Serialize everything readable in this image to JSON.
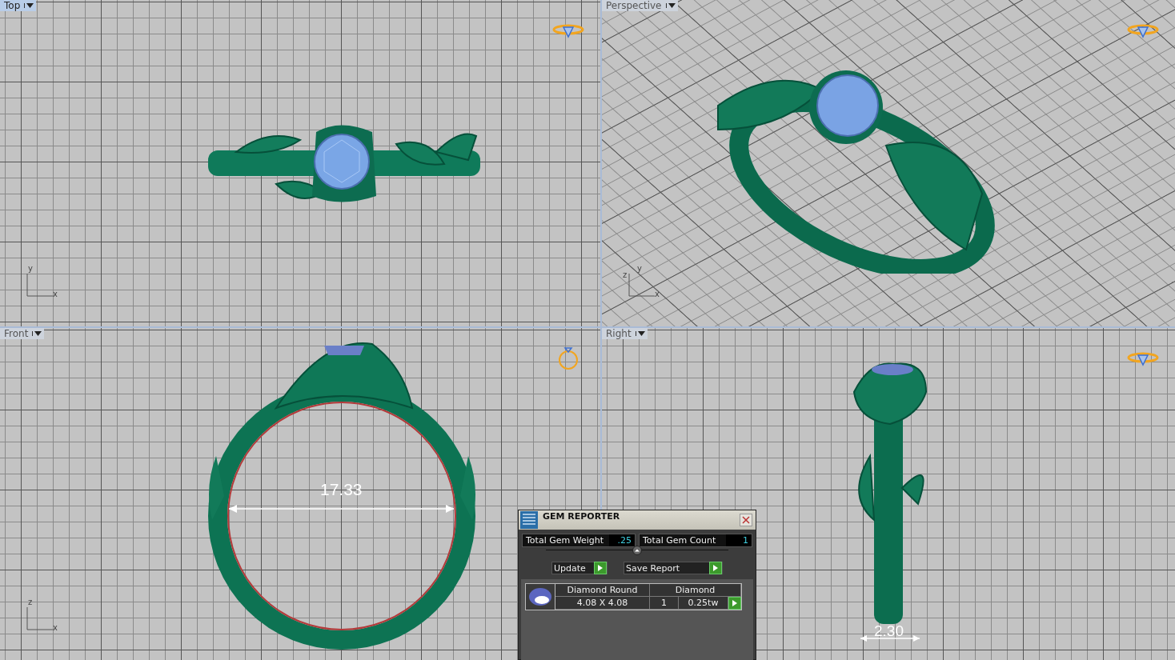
{
  "viewports": [
    {
      "label": "Top",
      "selected": true,
      "kind": "top",
      "axes": [
        "y",
        "x"
      ]
    },
    {
      "label": "Perspective",
      "selected": false,
      "kind": "perspective",
      "axes": [
        "z",
        "y",
        "x"
      ]
    },
    {
      "label": "Front",
      "selected": false,
      "kind": "front",
      "axes": [
        "z",
        "x"
      ],
      "dimension": "17.33"
    },
    {
      "label": "Right",
      "selected": false,
      "kind": "right",
      "dimension": "2.30"
    }
  ],
  "gem_reporter": {
    "title": "GEM REPORTER",
    "totals": [
      {
        "label": "Total Gem Weight",
        "value": ".25"
      },
      {
        "label": "Total Gem Count",
        "value": "1"
      }
    ],
    "buttons": [
      "Update",
      "Save Report"
    ],
    "gems": [
      {
        "name": "Diamond Round",
        "material": "Diamond",
        "size": "4.08 X 4.08",
        "count": "1",
        "weight": "0.25tw"
      }
    ]
  }
}
